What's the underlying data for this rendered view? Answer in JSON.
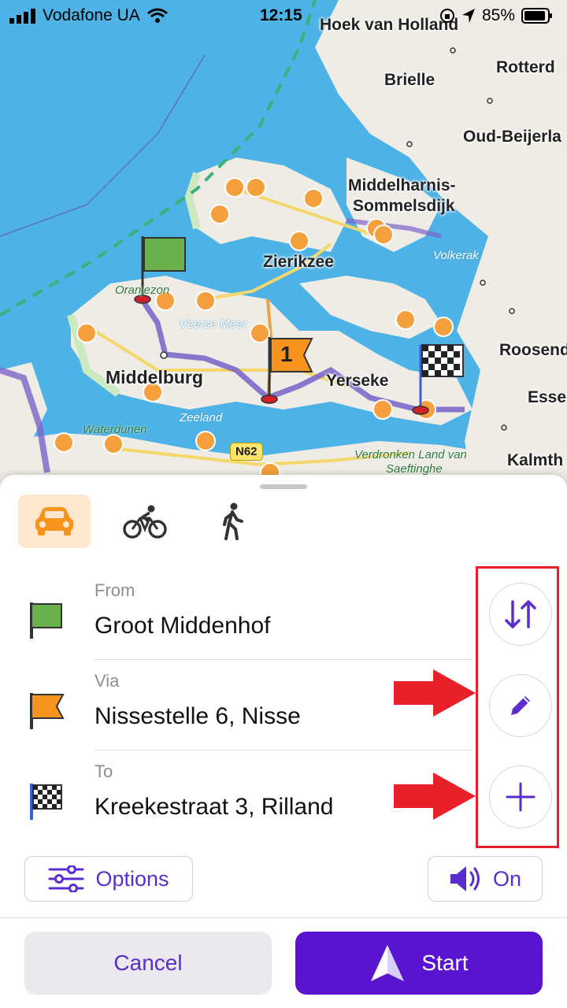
{
  "status_bar": {
    "carrier": "Vodafone UA",
    "time": "12:15",
    "battery": "85%"
  },
  "map": {
    "cities": [
      "Hoek van Holland",
      "Rotterd",
      "Brielle",
      "Oud-Beijerla",
      "Middelharnis-",
      "Sommelsdijk",
      "Zierikzee",
      "Roosend",
      "Esse",
      "Middelburg",
      "Yerseke",
      "Kalmth"
    ],
    "water_labels": [
      "Volkerak",
      "Oranjezon",
      "Veerse Meer",
      "Zeeland",
      "Waterdunen",
      "Verdronken Land van",
      "Saeftinghe"
    ],
    "road_badge": "N62",
    "via_marker_number": "1"
  },
  "modes": [
    {
      "name": "car",
      "icon": "car-icon",
      "selected": true
    },
    {
      "name": "bike",
      "icon": "bicycle-icon",
      "selected": false
    },
    {
      "name": "walk",
      "icon": "pedestrian-icon",
      "selected": false
    }
  ],
  "route": {
    "from": {
      "label": "From",
      "value": "Groot Middenhof"
    },
    "via": {
      "label": "Via",
      "value": "Nissestelle 6, Nisse"
    },
    "to": {
      "label": "To",
      "value": "Kreekestraat 3, Rilland"
    }
  },
  "actions": {
    "swap_icon": "swap-icon",
    "edit_icon": "pencil-icon",
    "add_icon": "plus-icon"
  },
  "options_label": "Options",
  "sound_label": "On",
  "cancel_label": "Cancel",
  "start_label": "Start",
  "colors": {
    "accent": "#5a14d0",
    "accent_text": "#5a2dcc",
    "highlight": "#e8202a",
    "car_bg": "#fde7cf",
    "orange": "#f7941d",
    "green_flag": "#6ab04c"
  }
}
